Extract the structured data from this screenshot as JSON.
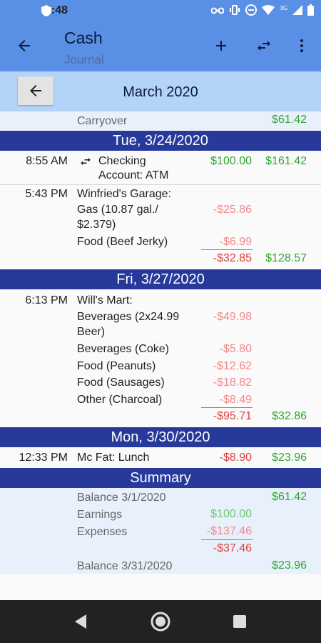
{
  "status": {
    "time": "5:48",
    "network": "3G"
  },
  "header": {
    "title": "Cash",
    "subtitle": "Journal"
  },
  "month": {
    "label": "March 2020"
  },
  "carryover": {
    "label": "Carryover",
    "balance": "$61.42"
  },
  "days": [
    {
      "header": "Tue, 3/24/2020"
    },
    {
      "header": "Fri, 3/27/2020"
    },
    {
      "header": "Mon, 3/30/2020"
    }
  ],
  "tx1": {
    "time": "8:55 AM",
    "desc_line1": "Checking",
    "desc_line2": "Account: ATM",
    "amount": "$100.00",
    "balance": "$161.42"
  },
  "tx2": {
    "time": "5:43 PM",
    "payee": "Winfried's Garage:",
    "items": [
      {
        "line1": "Gas (10.87 gal./",
        "line2": "$2.379)",
        "amount": "-$25.86"
      },
      {
        "line1": "Food (Beef Jerky)",
        "amount": "-$6.99"
      }
    ],
    "total": "-$32.85",
    "balance": "$128.57"
  },
  "tx3": {
    "time": "6:13 PM",
    "payee": "Will's Mart:",
    "items": [
      {
        "line1": "Beverages (2x24.99",
        "line2": "Beer)",
        "amount": "-$49.98"
      },
      {
        "line1": "Beverages (Coke)",
        "amount": "-$5.80"
      },
      {
        "line1": "Food (Peanuts)",
        "amount": "-$12.62"
      },
      {
        "line1": "Food (Sausages)",
        "amount": "-$18.82"
      },
      {
        "line1": "Other (Charcoal)",
        "amount": "-$8.49"
      }
    ],
    "total": "-$95.71",
    "balance": "$32.86"
  },
  "tx4": {
    "time": "12:33 PM",
    "desc": "Mc Fat: Lunch",
    "amount": "-$8.90",
    "balance": "$23.96"
  },
  "summary": {
    "header": "Summary",
    "opening_label": "Balance 3/1/2020",
    "opening": "$61.42",
    "earnings_label": "Earnings",
    "earnings": "$100.00",
    "expenses_label": "Expenses",
    "expenses": "-$137.46",
    "net": "-$37.46",
    "closing_label": "Balance 3/31/2020",
    "closing": "$23.96"
  },
  "colors": {
    "appbar": "#5a8fe6",
    "day_header": "#27399a",
    "negative": "#e04040",
    "positive": "#2ea62e"
  }
}
